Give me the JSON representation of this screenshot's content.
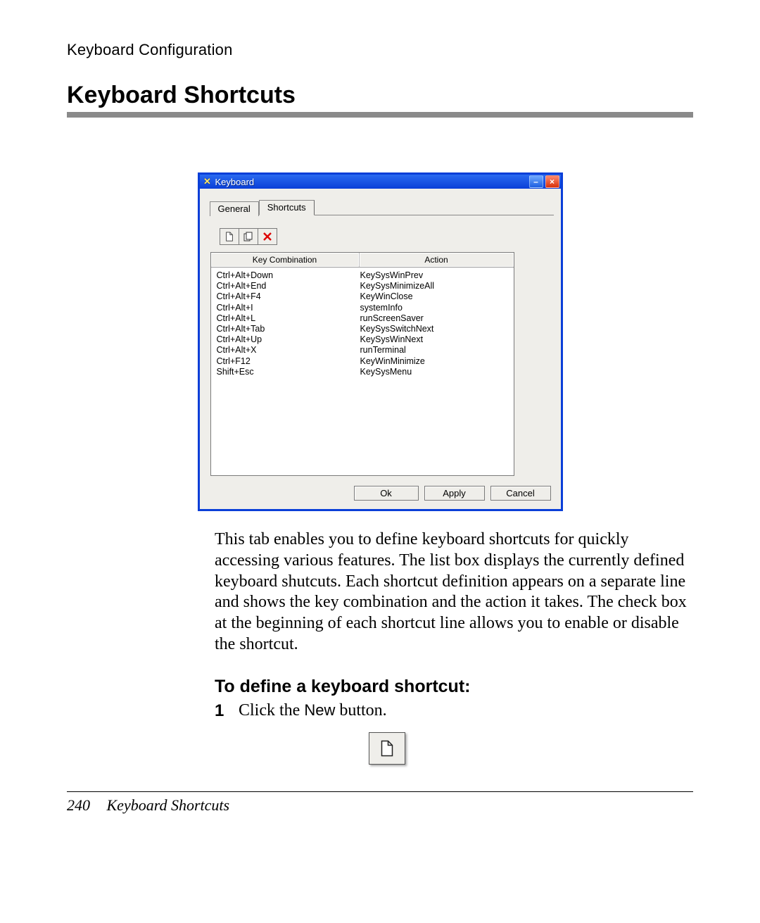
{
  "running_head": "Keyboard Configuration",
  "h1": "Keyboard Shortcuts",
  "window": {
    "title": "Keyboard",
    "tabs": {
      "general": "General",
      "shortcuts": "Shortcuts"
    },
    "columns": {
      "kc": "Key Combination",
      "ac": "Action"
    },
    "rows": [
      {
        "k": "Ctrl+Alt+Down",
        "a": "KeySysWinPrev"
      },
      {
        "k": "Ctrl+Alt+End",
        "a": "KeySysMinimizeAll"
      },
      {
        "k": "Ctrl+Alt+F4",
        "a": "KeyWinClose"
      },
      {
        "k": "Ctrl+Alt+I",
        "a": "systemInfo"
      },
      {
        "k": "Ctrl+Alt+L",
        "a": "runScreenSaver"
      },
      {
        "k": "Ctrl+Alt+Tab",
        "a": "KeySysSwitchNext"
      },
      {
        "k": "Ctrl+Alt+Up",
        "a": "KeySysWinNext"
      },
      {
        "k": "Ctrl+Alt+X",
        "a": "runTerminal"
      },
      {
        "k": "Ctrl+F12",
        "a": "KeyWinMinimize"
      },
      {
        "k": "Shift+Esc",
        "a": "KeySysMenu"
      }
    ],
    "buttons": {
      "ok": "Ok",
      "apply": "Apply",
      "cancel": "Cancel"
    }
  },
  "para": "This tab enables you to define keyboard shortcuts for quickly accessing various features. The list box displays the currently defined keyboard shutcuts. Each shortcut definition appears on a separate line and shows the key combination and the action it takes. The check box at the beginning of each shortcut line allows you to enable or disable the shortcut.",
  "h2": "To define a keyboard shortcut:",
  "step1_num": "1",
  "step1_a": "Click the ",
  "step1_b": "New",
  "step1_c": " button.",
  "footer": {
    "page": "240",
    "title": "Keyboard Shortcuts"
  }
}
